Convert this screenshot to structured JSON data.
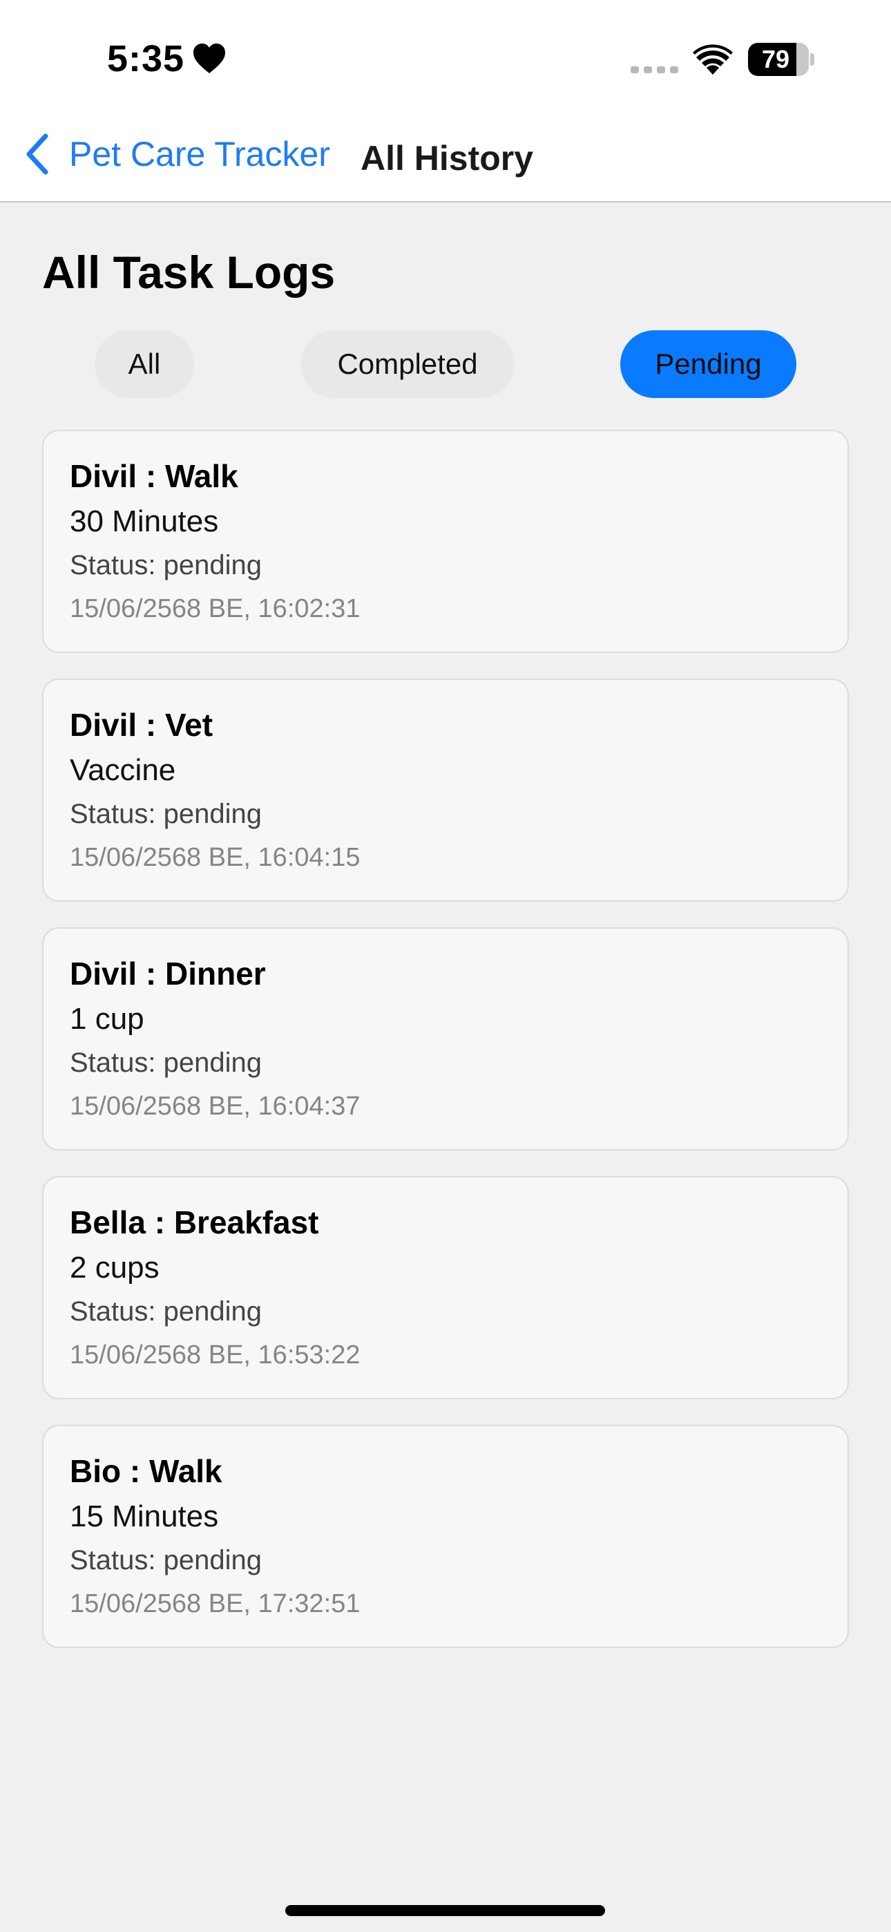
{
  "status_bar": {
    "time": "5:35",
    "battery_level": "79",
    "battery_fraction": 0.79
  },
  "nav": {
    "back_label": "Pet Care Tracker",
    "title": "All History"
  },
  "page": {
    "title": "All Task Logs"
  },
  "filters": [
    {
      "label": "All",
      "active": false
    },
    {
      "label": "Completed",
      "active": false
    },
    {
      "label": "Pending",
      "active": true
    }
  ],
  "logs": [
    {
      "title": "Divil : Walk",
      "detail": "30 Minutes",
      "status": "Status: pending",
      "timestamp": "15/06/2568 BE, 16:02:31"
    },
    {
      "title": "Divil : Vet",
      "detail": "Vaccine",
      "status": "Status: pending",
      "timestamp": "15/06/2568 BE, 16:04:15"
    },
    {
      "title": "Divil : Dinner",
      "detail": "1 cup",
      "status": "Status: pending",
      "timestamp": "15/06/2568 BE, 16:04:37"
    },
    {
      "title": "Bella : Breakfast",
      "detail": "2 cups",
      "status": "Status: pending",
      "timestamp": "15/06/2568 BE, 16:53:22"
    },
    {
      "title": "Bio : Walk",
      "detail": "15 Minutes",
      "status": "Status: pending",
      "timestamp": "15/06/2568 BE, 17:32:51"
    }
  ],
  "colors": {
    "accent": "#0a7bff",
    "link": "#1d7cf2",
    "background": "#f0f0f0",
    "card": "#f7f7f7"
  }
}
